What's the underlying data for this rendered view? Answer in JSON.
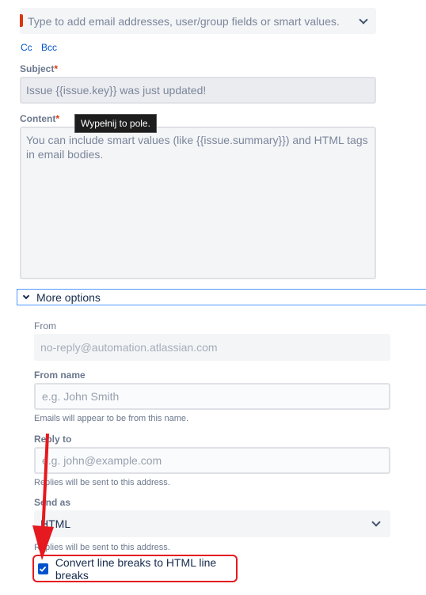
{
  "to_field": {
    "placeholder": "Type to add email addresses, user/group fields or smart values."
  },
  "recipients": {
    "cc_label": "Cc",
    "bcc_label": "Bcc"
  },
  "subject": {
    "label": "Subject",
    "required_mark": "*",
    "value": "Issue {{issue.key}} was just updated!"
  },
  "content": {
    "label": "Content",
    "required_mark": "*",
    "placeholder": "You can include smart values (like {{issue.summary}}) and HTML tags in email bodies.",
    "tooltip": "Wypełnij to pole."
  },
  "more_options": {
    "label": "More options",
    "from": {
      "label": "From",
      "value": "no-reply@automation.atlassian.com"
    },
    "from_name": {
      "label": "From name",
      "placeholder": "e.g. John Smith",
      "helper": "Emails will appear to be from this name."
    },
    "reply_to": {
      "label": "Reply to",
      "placeholder": "e.g. john@example.com",
      "helper": "Replies will be sent to this address."
    },
    "send_as": {
      "label": "Send as",
      "value": "HTML",
      "helper": "Replies will be sent to this address."
    },
    "convert_line_breaks": {
      "label": "Convert line breaks to HTML line breaks",
      "checked": true
    }
  },
  "annotation": {
    "highlight_color": "#e5191f"
  }
}
